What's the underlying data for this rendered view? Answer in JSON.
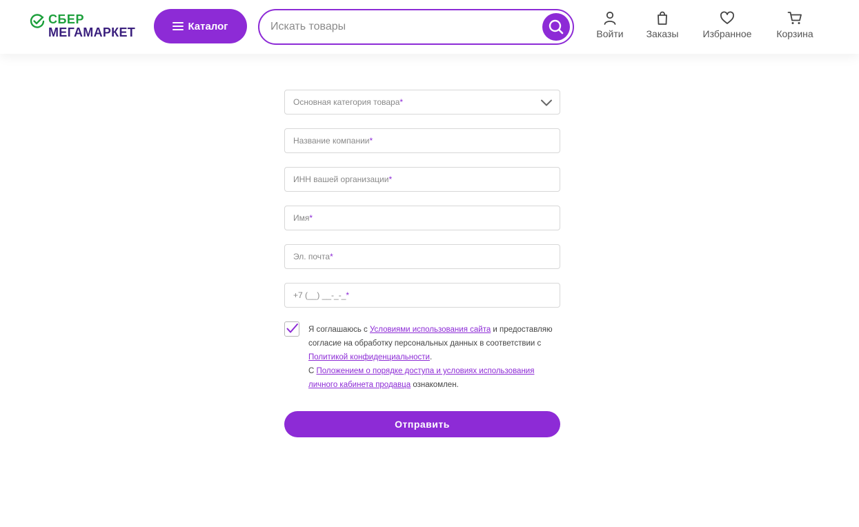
{
  "brand": {
    "line1": "СБЕР",
    "line2": "МЕГАМАРКЕТ",
    "colors": {
      "green": "#1d9f3c",
      "purple_dark": "#3a1f7d",
      "accent": "#8d2bd6"
    }
  },
  "header": {
    "catalog_label": "Каталог",
    "search_placeholder": "Искать товары",
    "nav": [
      {
        "label": "Войти",
        "icon": "user-icon"
      },
      {
        "label": "Заказы",
        "icon": "shopping-bag-icon"
      },
      {
        "label": "Избранное",
        "icon": "heart-icon"
      },
      {
        "label": "Корзина",
        "icon": "cart-icon"
      }
    ]
  },
  "form": {
    "category": {
      "placeholder": "Основная категория товара",
      "required": "*"
    },
    "company": {
      "placeholder": "Название компании",
      "required": "*"
    },
    "inn": {
      "placeholder": "ИНН вашей организации",
      "required": "*"
    },
    "name": {
      "placeholder": "Имя",
      "required": "*"
    },
    "email": {
      "placeholder": "Эл. почта",
      "required": "*"
    },
    "phone": {
      "placeholder": "+7 (__) __-_-_",
      "required": "*"
    },
    "consent": {
      "checked": true,
      "p1_before": "Я соглашаюсь с ",
      "link_terms": "Условиями использования сайта",
      "p1_after": " и предоставляю согласие на обработку персональных данных в соответствии с ",
      "link_privacy": "Политикой конфиденциальности",
      "p1_end": ".",
      "p2_before": "С ",
      "link_rules": "Положением о порядке доступа и условиях использования личного кабинета продавца",
      "p2_after": " ознакомлен."
    },
    "submit_label": "Отправить"
  }
}
